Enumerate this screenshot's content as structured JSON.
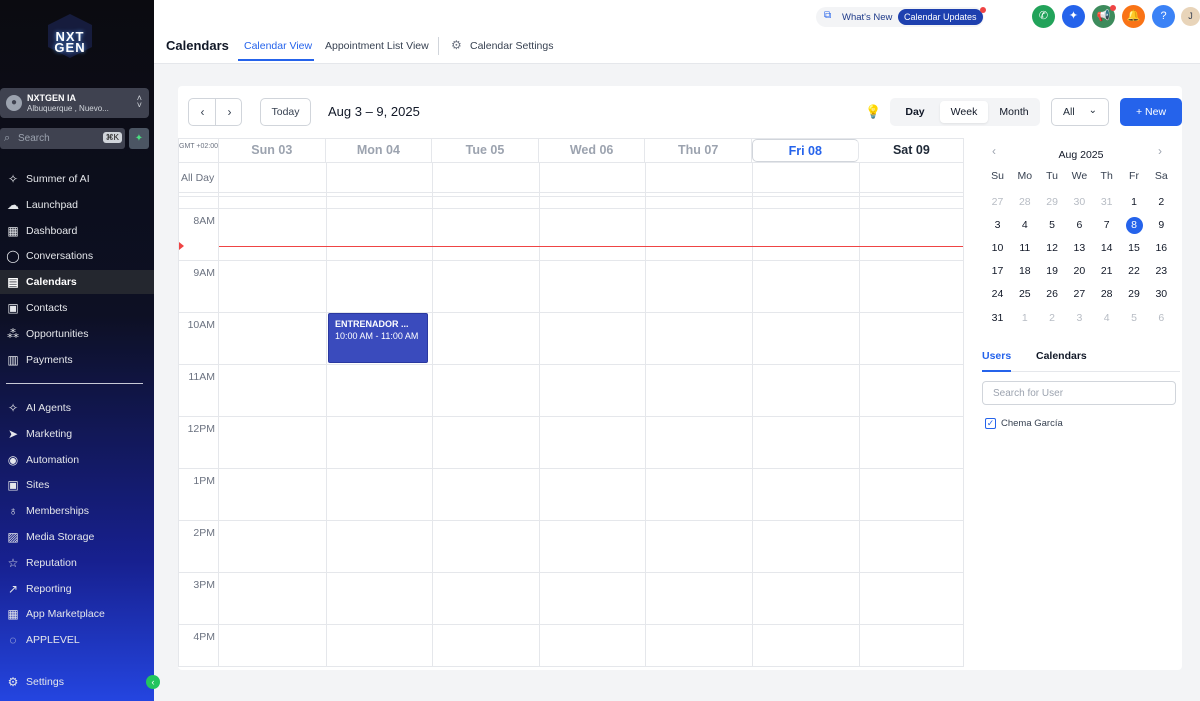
{
  "sidebar": {
    "logo_text": "NXT GEN",
    "account": {
      "name": "NXTGEN IA",
      "location": "Albuquerque , Nuevo..."
    },
    "search": {
      "placeholder": "Search",
      "shortcut": "⌘K"
    },
    "items": [
      {
        "label": "Summer of AI",
        "icon": "sparkle-icon"
      },
      {
        "label": "Launchpad",
        "icon": "rocket-icon"
      },
      {
        "label": "Dashboard",
        "icon": "dashboard-icon"
      },
      {
        "label": "Conversations",
        "icon": "chat-icon"
      },
      {
        "label": "Calendars",
        "icon": "calendar-icon",
        "active": true
      },
      {
        "label": "Contacts",
        "icon": "contacts-icon"
      },
      {
        "label": "Opportunities",
        "icon": "opportunities-icon"
      },
      {
        "label": "Payments",
        "icon": "payments-icon"
      }
    ],
    "items2": [
      {
        "label": "AI Agents",
        "icon": "ai-agents-icon"
      },
      {
        "label": "Marketing",
        "icon": "marketing-icon"
      },
      {
        "label": "Automation",
        "icon": "automation-icon"
      },
      {
        "label": "Sites",
        "icon": "sites-icon"
      },
      {
        "label": "Memberships",
        "icon": "memberships-icon"
      },
      {
        "label": "Media Storage",
        "icon": "media-icon"
      },
      {
        "label": "Reputation",
        "icon": "star-icon"
      },
      {
        "label": "Reporting",
        "icon": "reporting-icon"
      },
      {
        "label": "App Marketplace",
        "icon": "apps-icon"
      },
      {
        "label": "APPLEVEL",
        "icon": "whatsapp-icon"
      }
    ],
    "settings_label": "Settings"
  },
  "header": {
    "title": "Calendars",
    "tabs": [
      {
        "label": "Calendar View",
        "active": true
      },
      {
        "label": "Appointment List View"
      },
      {
        "label": "Calendar Settings"
      }
    ],
    "whats_new": "What's New",
    "calendar_updates": "Calendar Updates",
    "user_initial": "J"
  },
  "toolbar": {
    "today": "Today",
    "range": "Aug 3 – 9, 2025",
    "views": [
      "Day",
      "Week",
      "Month"
    ],
    "selected_view": "Week",
    "filter": "All",
    "new_label": "+ New"
  },
  "grid": {
    "gmt": "GMT +02:00",
    "all_day": "All Day",
    "days": [
      "Sun 03",
      "Mon 04",
      "Tue 05",
      "Wed 06",
      "Thu 07",
      "Fri 08",
      "Sat 09"
    ],
    "hours": [
      "8AM",
      "9AM",
      "10AM",
      "11AM",
      "12PM",
      "1PM",
      "2PM",
      "3PM",
      "4PM"
    ],
    "event": {
      "title": "ENTRENADOR ...",
      "time": "10:00 AM - 11:00 AM"
    }
  },
  "minical": {
    "title": "Aug 2025",
    "dow": [
      "Su",
      "Mo",
      "Tu",
      "We",
      "Th",
      "Fr",
      "Sa"
    ],
    "weeks": [
      [
        "27",
        "28",
        "29",
        "30",
        "31",
        "1",
        "2"
      ],
      [
        "3",
        "4",
        "5",
        "6",
        "7",
        "8",
        "9"
      ],
      [
        "10",
        "11",
        "12",
        "13",
        "14",
        "15",
        "16"
      ],
      [
        "17",
        "18",
        "19",
        "20",
        "21",
        "22",
        "23"
      ],
      [
        "24",
        "25",
        "26",
        "27",
        "28",
        "29",
        "30"
      ],
      [
        "31",
        "1",
        "2",
        "3",
        "4",
        "5",
        "6"
      ]
    ],
    "selected": "8"
  },
  "right": {
    "tabs": [
      "Users",
      "Calendars"
    ],
    "search_placeholder": "Search for User",
    "users": [
      {
        "name": "Chema García",
        "checked": true
      }
    ]
  },
  "colors": {
    "accent": "#2563eb",
    "event": "#3a4bbd",
    "now": "#ef4444"
  }
}
